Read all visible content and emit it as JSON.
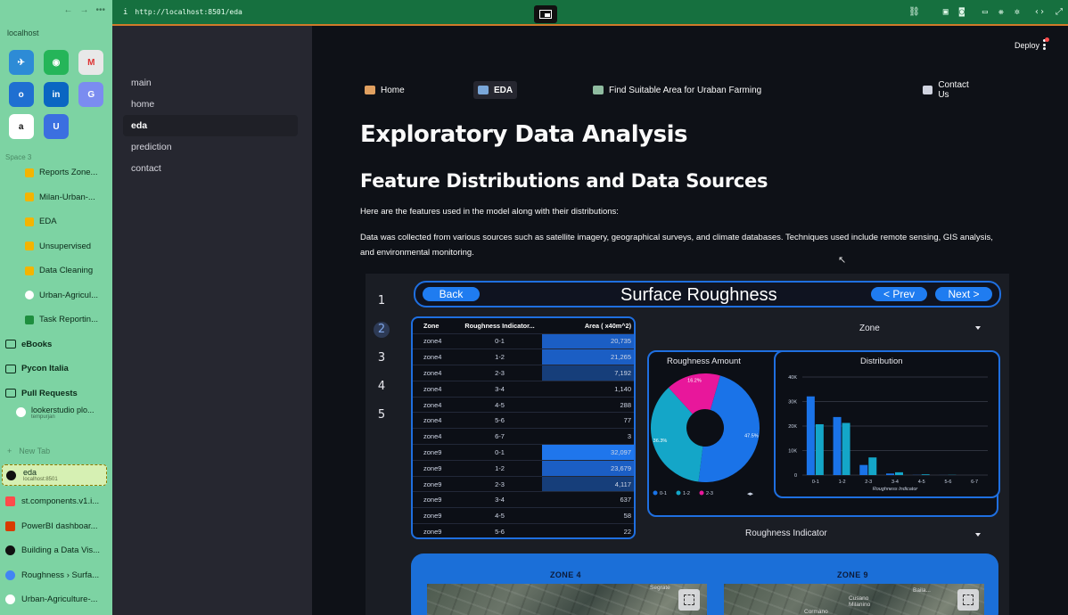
{
  "browser": {
    "host_label": "localhost",
    "url": "http://localhost:8501/eda",
    "space_label": "Space 3",
    "pinned_tabs": [
      "Reports Zone...",
      "Milan-Urban-...",
      "EDA",
      "Unsupervised",
      "Data Cleaning",
      "Urban-Agricul...",
      "Task Reportin..."
    ],
    "folders": [
      "eBooks",
      "Pycon Italia",
      "Pull Requests"
    ],
    "pr_item": {
      "title": "lookerstudio plo...",
      "subtitle": "tempurjan"
    },
    "new_tab_label": "New Tab",
    "active_tab": {
      "title": "eda",
      "subtitle": "localhost:8501"
    },
    "other_tabs": [
      "st.components.v1.i...",
      "PowerBI dashboar...",
      "Building a Data Vis...",
      "Roughness › Surfa...",
      "Urban-Agriculture-..."
    ],
    "colors": {
      "sidebar_bg": "#7dd3a3",
      "urlbar_bg": "#16703f"
    }
  },
  "streamlit": {
    "nav": [
      "main",
      "home",
      "eda",
      "prediction",
      "contact"
    ],
    "active_nav": "eda",
    "deploy_label": "Deploy",
    "topnav": {
      "home": "Home",
      "eda": "EDA",
      "find": "Find Suitable Area for Uraban Farming",
      "contact": "Contact Us"
    },
    "title": "Exploratory Data Analysis",
    "subtitle": "Feature Distributions and Data Sources",
    "para1": "Here are the features used in the model along with their distributions:",
    "para2": "Data was collected from various sources such as satellite imagery, geographical surveys, and climate databases. Techniques used include remote sensing, GIS analysis, and environmental monitoring."
  },
  "report": {
    "pages": [
      "1",
      "2",
      "3",
      "4",
      "5"
    ],
    "active_page": "2",
    "back_label": "Back",
    "title": "Surface Roughness",
    "prev_label": "< Prev",
    "next_label": "Next >",
    "table": {
      "headers": [
        "Zone",
        "Roughness Indicator...",
        "Area ( x40m^2)"
      ],
      "rows": [
        {
          "zone": "zone4",
          "ri": "0-1",
          "area": "20,735",
          "hl": 2
        },
        {
          "zone": "zone4",
          "ri": "1-2",
          "area": "21,265",
          "hl": 2
        },
        {
          "zone": "zone4",
          "ri": "2-3",
          "area": "7,192",
          "hl": 1
        },
        {
          "zone": "zone4",
          "ri": "3-4",
          "area": "1,140",
          "hl": 0
        },
        {
          "zone": "zone4",
          "ri": "4-5",
          "area": "288",
          "hl": 0
        },
        {
          "zone": "zone4",
          "ri": "5-6",
          "area": "77",
          "hl": 0
        },
        {
          "zone": "zone4",
          "ri": "6-7",
          "area": "3",
          "hl": 0
        },
        {
          "zone": "zone9",
          "ri": "0-1",
          "area": "32,097",
          "hl": 3
        },
        {
          "zone": "zone9",
          "ri": "1-2",
          "area": "23,679",
          "hl": 2
        },
        {
          "zone": "zone9",
          "ri": "2-3",
          "area": "4,117",
          "hl": 1
        },
        {
          "zone": "zone9",
          "ri": "3-4",
          "area": "637",
          "hl": 0
        },
        {
          "zone": "zone9",
          "ri": "4-5",
          "area": "58",
          "hl": 0
        },
        {
          "zone": "zone9",
          "ri": "5-6",
          "area": "22",
          "hl": 0
        }
      ]
    },
    "zone_slicer": "Zone",
    "ri_slicer": "Roughness Indicator",
    "map_labels": [
      "ZONE 4",
      "ZONE 9"
    ],
    "map_texts": [
      "Segrate",
      "Baila...",
      "Cusano",
      "Milanino",
      "Cormano"
    ]
  },
  "chart_data": [
    {
      "type": "pie",
      "title": "Roughness Amount",
      "categories": [
        "0-1",
        "1-2",
        "2-3"
      ],
      "values": [
        47.5,
        36.3,
        16.2
      ],
      "labels": [
        "47.5%",
        "36.3%",
        "16.2%"
      ],
      "colors": [
        "#1a73e8",
        "#14a6c8",
        "#e8179b"
      ],
      "legend": "bottom-left",
      "legend_labels": [
        "0-1",
        "1-2",
        "2-3"
      ]
    },
    {
      "type": "bar",
      "title": "Distribution",
      "categories": [
        "0-1",
        "1-2",
        "2-3",
        "3-4",
        "4-5",
        "5-6",
        "6-7"
      ],
      "series": [
        {
          "values": [
            32097,
            23679,
            4117,
            637,
            58,
            22,
            0
          ],
          "color": "#1a73e8"
        },
        {
          "values": [
            20735,
            21265,
            7192,
            1140,
            288,
            77,
            3
          ],
          "color": "#14a6c8"
        }
      ],
      "xlabel": "Roughness Indicator",
      "ylabel": "",
      "ylim": [
        0,
        40000
      ],
      "yticks": [
        "0",
        "10K",
        "20K",
        "30K",
        "40K"
      ],
      "grid": true
    }
  ]
}
